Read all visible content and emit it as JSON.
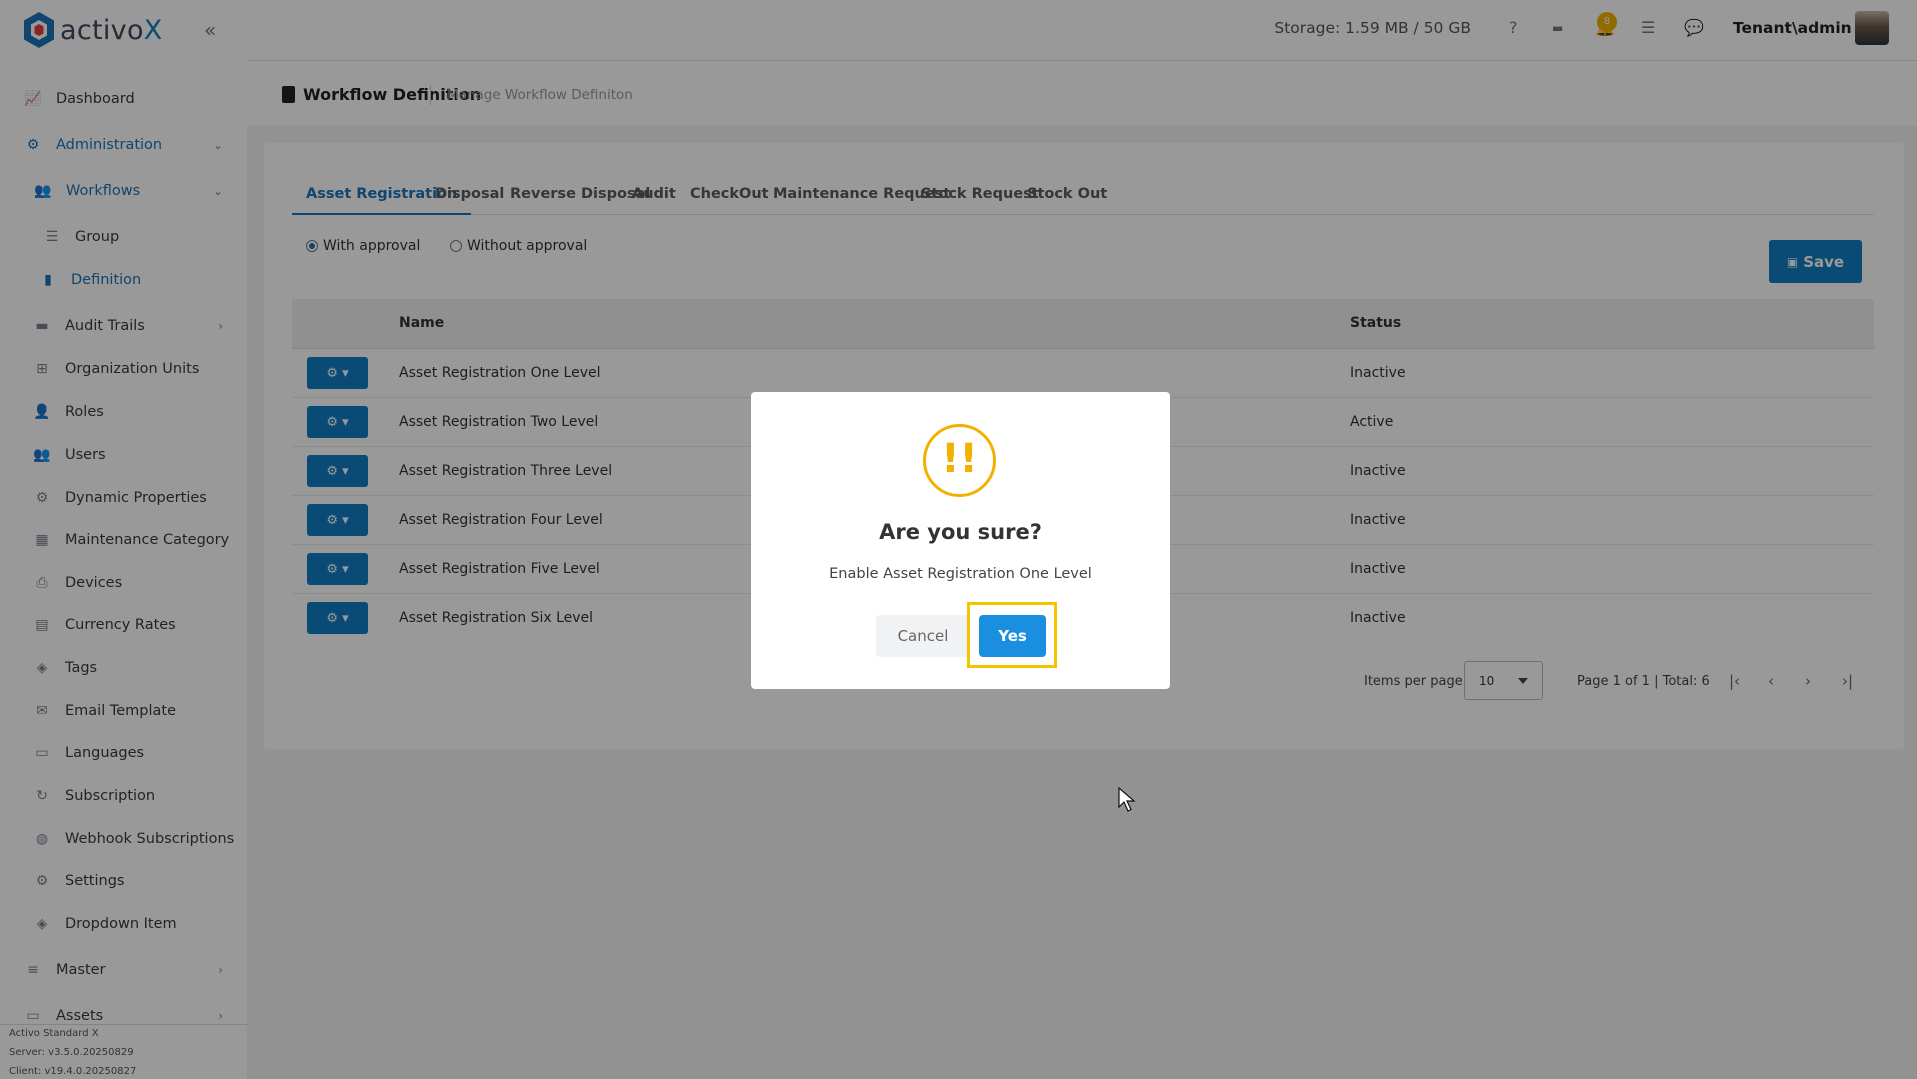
{
  "app": {
    "logo_text_main": "activo",
    "logo_text_accent": "X"
  },
  "topbar": {
    "storage": "Storage: 1.59 MB / 50 GB",
    "notification_count": "8",
    "user": "Tenant\\admin"
  },
  "sidebar": {
    "items": [
      {
        "label": "Dashboard",
        "icon": "chart-icon"
      },
      {
        "label": "Administration",
        "icon": "gears-icon"
      },
      {
        "label": "Workflows",
        "icon": "users-icon"
      },
      {
        "label": "Group",
        "icon": "list-icon"
      },
      {
        "label": "Definition",
        "icon": "clipboard-icon"
      },
      {
        "label": "Audit Trails",
        "icon": "folder-icon"
      },
      {
        "label": "Organization Units",
        "icon": "sitemap-icon"
      },
      {
        "label": "Roles",
        "icon": "user-icon"
      },
      {
        "label": "Users",
        "icon": "users-icon"
      },
      {
        "label": "Dynamic Properties",
        "icon": "gear-icon"
      },
      {
        "label": "Maintenance Category",
        "icon": "grid-icon"
      },
      {
        "label": "Devices",
        "icon": "printer-icon"
      },
      {
        "label": "Currency Rates",
        "icon": "money-icon"
      },
      {
        "label": "Tags",
        "icon": "tags-icon"
      },
      {
        "label": "Email Template",
        "icon": "envelope-icon"
      },
      {
        "label": "Languages",
        "icon": "language-icon"
      },
      {
        "label": "Subscription",
        "icon": "refresh-icon"
      },
      {
        "label": "Webhook Subscriptions",
        "icon": "globe-icon"
      },
      {
        "label": "Settings",
        "icon": "gear-icon"
      },
      {
        "label": "Dropdown Item",
        "icon": "tags-icon"
      },
      {
        "label": "Master",
        "icon": "database-icon"
      },
      {
        "label": "Assets",
        "icon": "laptop-icon"
      }
    ],
    "footer": {
      "product": "Activo Standard X",
      "server": "Server: v3.5.0.20250829",
      "client": "Client: v19.4.0.20250827"
    }
  },
  "header": {
    "title": "Workflow Definition",
    "subtitle": "Manage Workflow Definiton"
  },
  "tabs": [
    {
      "label": "Asset Registration",
      "active": true
    },
    {
      "label": "Disposal"
    },
    {
      "label": "Reverse Disposal"
    },
    {
      "label": "Audit"
    },
    {
      "label": "CheckOut"
    },
    {
      "label": "Maintenance Request"
    },
    {
      "label": "Stock Request"
    },
    {
      "label": "Stock Out"
    }
  ],
  "approval": {
    "with_label": "With approval",
    "without_label": "Without approval",
    "selected": "with"
  },
  "save_label": "Save",
  "table": {
    "columns": [
      "Name",
      "Status"
    ],
    "rows": [
      {
        "name": "Asset Registration One Level",
        "status": "Inactive"
      },
      {
        "name": "Asset Registration Two Level",
        "status": "Active"
      },
      {
        "name": "Asset Registration Three Level",
        "status": "Inactive"
      },
      {
        "name": "Asset Registration Four Level",
        "status": "Inactive"
      },
      {
        "name": "Asset Registration Five Level",
        "status": "Inactive"
      },
      {
        "name": "Asset Registration Six Level",
        "status": "Inactive"
      }
    ]
  },
  "pagination": {
    "items_per_page_label": "Items per page",
    "items_per_page_value": "10",
    "page_info": "Page 1 of 1 | Total: 6"
  },
  "modal": {
    "title": "Are you sure?",
    "text": "Enable Asset Registration One Level",
    "cancel_label": "Cancel",
    "yes_label": "Yes",
    "icon": "warning-icon"
  },
  "colors": {
    "primary": "#0f7dc2",
    "warning": "#f2b100",
    "highlight": "#f5c400"
  }
}
